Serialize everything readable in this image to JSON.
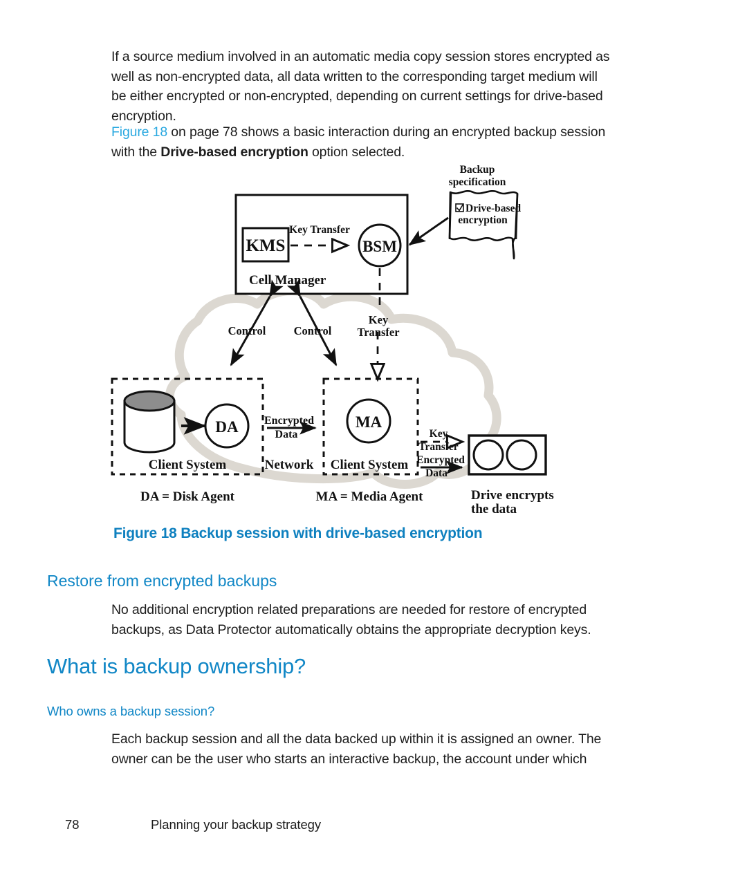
{
  "page": {
    "number": "78",
    "running_title": "Planning your backup strategy"
  },
  "colors": {
    "accent_blue": "#1187c6",
    "caption_blue": "#0e80bf",
    "xref_blue": "#29a8e0",
    "cloud_gray": "#dcd8d1",
    "disk_top_gray": "#8d8d8d",
    "ink": "#1b1b1b"
  },
  "body": {
    "para1": "If a source medium involved in an automatic media copy session stores encrypted as well as non-encrypted data, all data written to the corresponding target medium will be either encrypted or non-encrypted, depending on current settings for drive-based encryption.",
    "para2_before": "",
    "para2_xref": "Figure 18",
    "para2_mid": " on page 78 shows a basic interaction during an encrypted backup session with the ",
    "para2_bold": "Drive-based encryption",
    "para2_after": " option selected.",
    "para3": "No additional encryption related preparations are needed for restore of encrypted backups, as Data Protector automatically obtains the appropriate decryption keys.",
    "para4": "Each backup session and all the data backed up within it is assigned an owner. The owner can be the user who starts an interactive backup, the account under which"
  },
  "headings": {
    "figure_caption": "Figure 18 Backup session with drive-based encryption",
    "restore_heading": "Restore from encrypted backups",
    "ownership_heading": "What is backup ownership?",
    "who_owns_heading": "Who owns a backup session?"
  },
  "figure": {
    "cell_manager": {
      "title": "Cell Manager",
      "kms": "KMS",
      "bsm": "BSM",
      "key_transfer_label": "Key Transfer"
    },
    "backup_spec": {
      "title_line1": "Backup",
      "title_line2": "specification",
      "checkbox_checked": true,
      "option_line1": "Drive-based",
      "option_line2": "encryption"
    },
    "middle_arrows": {
      "control_left": "Control",
      "control_right": "Control",
      "key_transfer_line1": "Key",
      "key_transfer_line2": "Transfer"
    },
    "client_left": {
      "box_label": "Client System",
      "agent": "DA",
      "legend": "DA = Disk Agent"
    },
    "network": {
      "box_label": "Network",
      "encrypted_line1": "Encrypted",
      "encrypted_line2": "Data"
    },
    "client_right": {
      "box_label": "Client System",
      "agent": "MA",
      "legend": "MA = Media Agent"
    },
    "drive": {
      "key_transfer_line1": "Key",
      "key_transfer_line2": "Transfer",
      "encrypted_line1": "Encrypted",
      "encrypted_line2": "Data",
      "legend_line1": "Drive encrypts",
      "legend_line2": "the data"
    }
  }
}
